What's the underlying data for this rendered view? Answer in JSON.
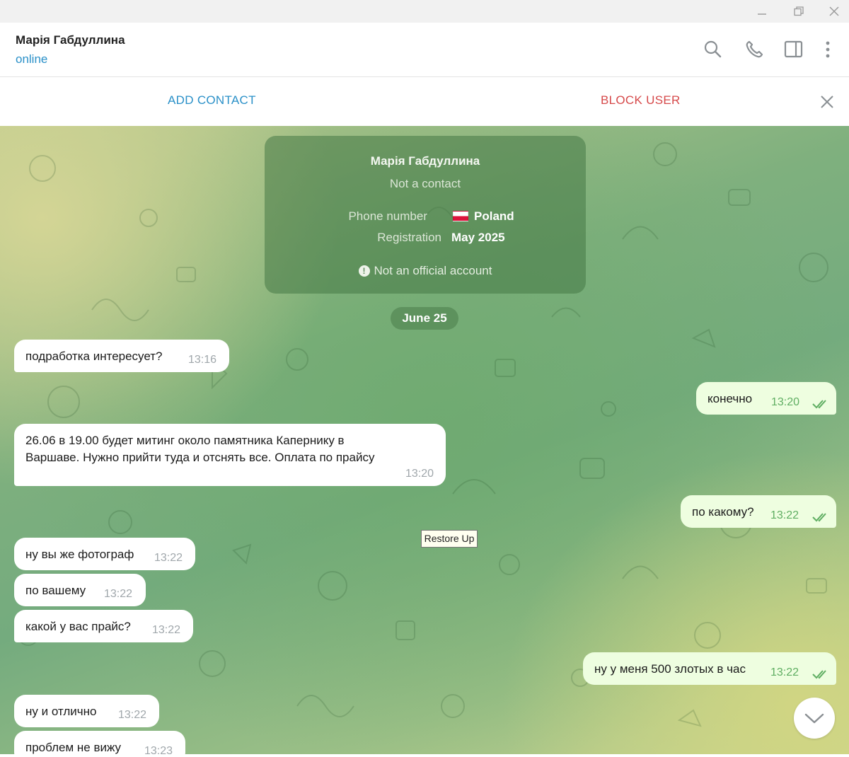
{
  "header": {
    "peer_name": "Марія Габдуллина",
    "peer_status": "online",
    "icons": [
      "search-icon",
      "phone-icon",
      "sidebar-toggle-icon",
      "more-vertical-icon"
    ]
  },
  "action_bar": {
    "add_contact": "ADD CONTACT",
    "block_user": "BLOCK USER"
  },
  "info_card": {
    "name": "Марія Габдуллина",
    "subtitle": "Not a contact",
    "phone_label": "Phone number",
    "phone_value": "Poland",
    "registration_label": "Registration",
    "registration_value": "May 2025",
    "warning": "Not an official account"
  },
  "date_separator": "June 25",
  "messages": [
    {
      "dir": "in",
      "text": "подработка интересует?",
      "time": "13:16"
    },
    {
      "dir": "out",
      "text": "конечно",
      "time": "13:20"
    },
    {
      "dir": "in",
      "text": "26.06 в 19.00 будет митинг около памятника Капернику в\nВаршаве. Нужно прийти туда и отснять все. Оплата по прайсу",
      "time": "13:20"
    },
    {
      "dir": "out",
      "text": "по какому?",
      "time": "13:22"
    },
    {
      "dir": "in",
      "text": "ну вы же фотограф",
      "time": "13:22"
    },
    {
      "dir": "in",
      "text": "по вашему",
      "time": "13:22"
    },
    {
      "dir": "in",
      "text": "какой у вас прайс?",
      "time": "13:22"
    },
    {
      "dir": "out",
      "text": "ну у меня 500 злотых в час",
      "time": "13:22"
    },
    {
      "dir": "in",
      "text": "ну и отлично",
      "time": "13:22"
    },
    {
      "dir": "in",
      "text": "проблем не вижу",
      "time": "13:23"
    }
  ],
  "tooltip": "Restore Up",
  "colors": {
    "accent": "#2a90c8",
    "danger": "#d6494a",
    "bubble_in": "#ffffff",
    "bubble_out": "#eefee0",
    "read_check": "#5fae62"
  }
}
